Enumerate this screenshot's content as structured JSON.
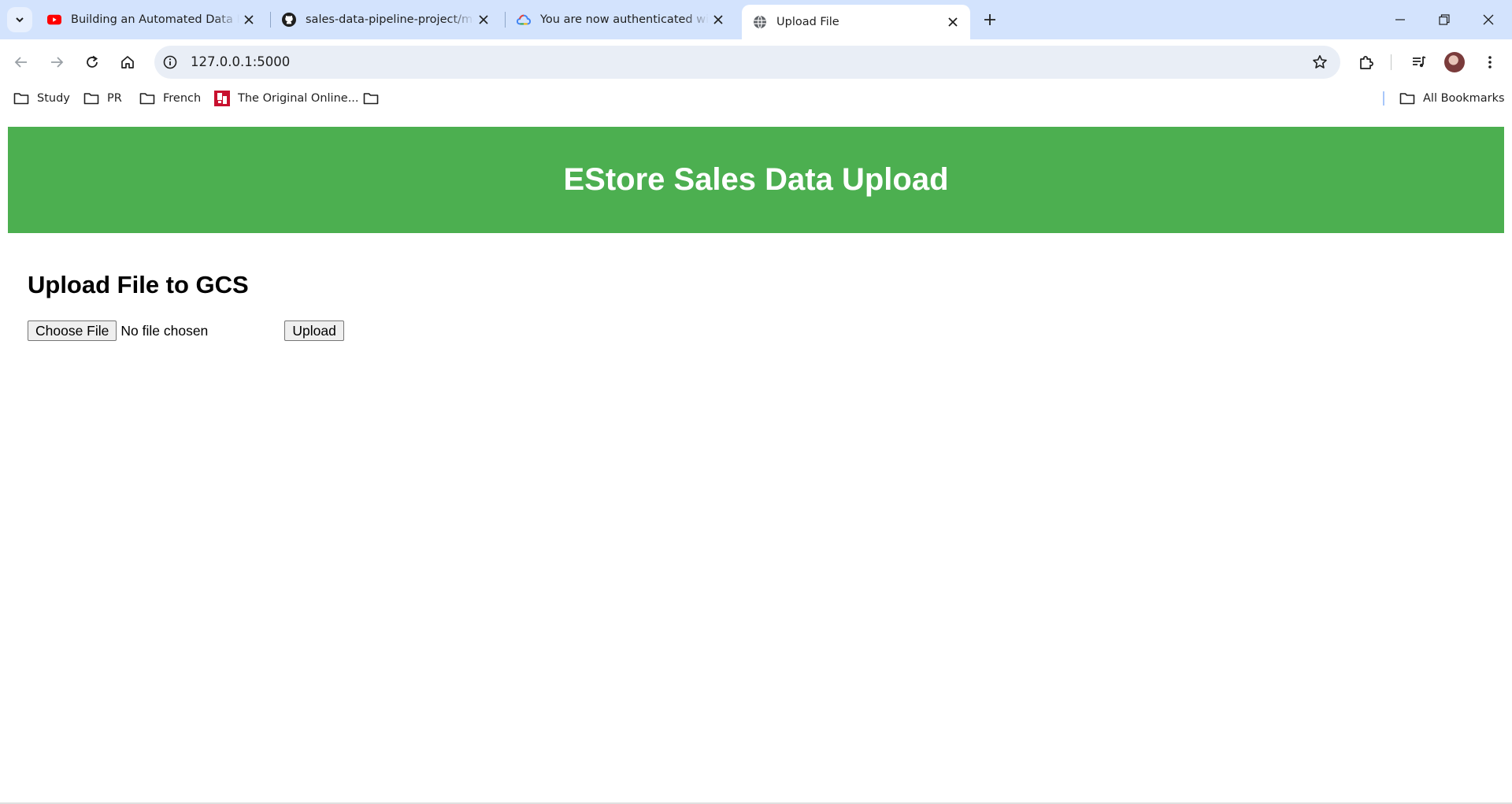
{
  "browser": {
    "tabs": [
      {
        "title": "Building an Automated Data Pipeline",
        "favicon": "youtube-icon",
        "active": false
      },
      {
        "title": "sales-data-pipeline-project/main",
        "favicon": "github-icon",
        "active": false
      },
      {
        "title": "You are now authenticated with the Google Cloud SDK",
        "favicon": "google-cloud-icon",
        "active": false
      },
      {
        "title": "Upload File",
        "favicon": "globe-icon",
        "active": true
      }
    ],
    "url": "127.0.0.1:5000",
    "bookmarks": [
      {
        "label": "Study",
        "icon": "folder-icon"
      },
      {
        "label": "PR",
        "icon": "folder-icon"
      },
      {
        "label": "French",
        "icon": "folder-icon"
      },
      {
        "label": "The Original Online...",
        "icon": "bookmark-favicon"
      },
      {
        "label": "",
        "icon": "folder-icon"
      }
    ],
    "all_bookmarks_label": "All Bookmarks"
  },
  "page": {
    "banner_title": "EStore Sales Data Upload",
    "banner_color": "#4caf50",
    "heading": "Upload File to GCS",
    "choose_file_label": "Choose File",
    "file_status": "No file chosen",
    "upload_label": "Upload"
  }
}
